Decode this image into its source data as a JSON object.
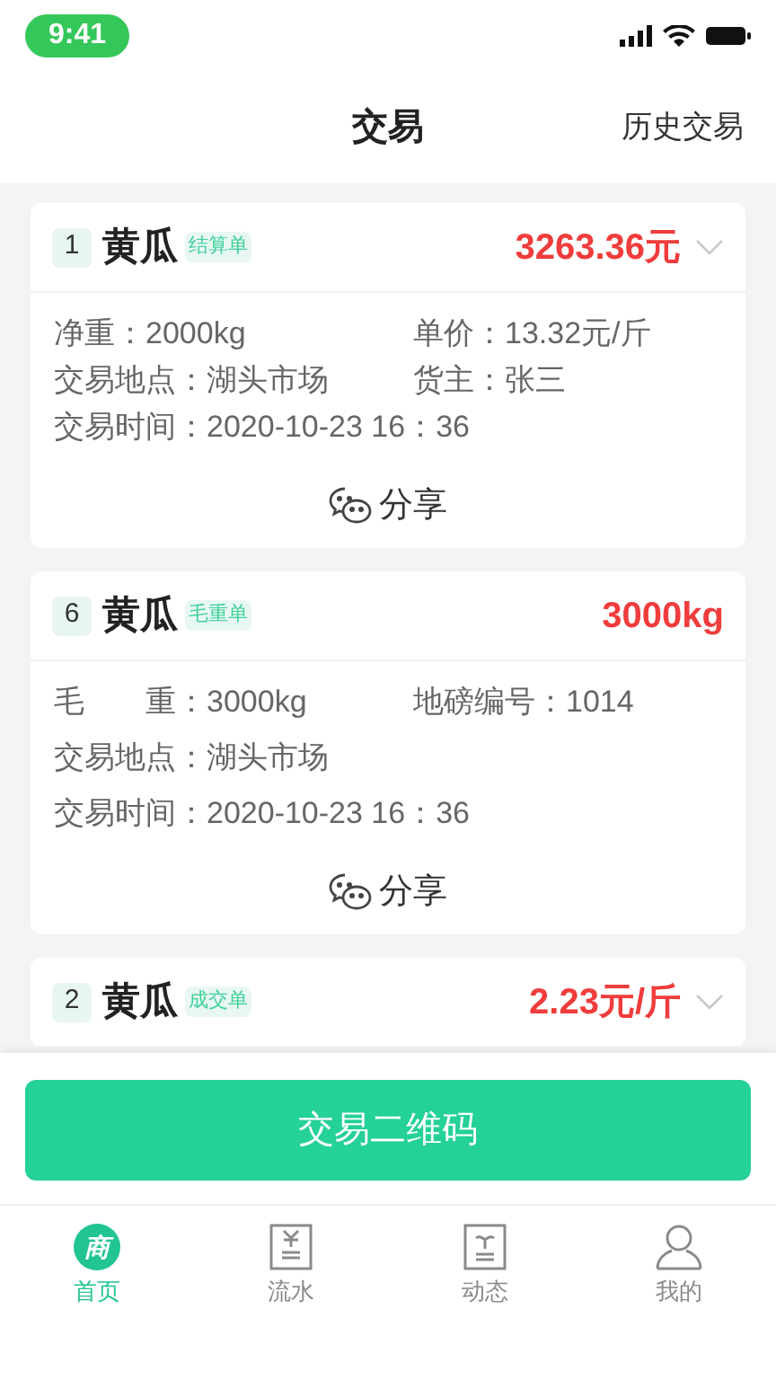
{
  "status_bar": {
    "time": "9:41"
  },
  "header": {
    "title": "交易",
    "action": "历史交易"
  },
  "cards": [
    {
      "index": "1",
      "name": "黄瓜",
      "tag": "结算单",
      "amount": "3263.36元",
      "collapsible": true,
      "rows": [
        [
          {
            "label": "净重：",
            "value": "2000kg"
          },
          {
            "label": "单价：",
            "value": "13.32元/斤"
          }
        ],
        [
          {
            "label": "交易地点：",
            "value": "湖头市场"
          },
          {
            "label": "货主：",
            "value": "张三"
          }
        ],
        [
          {
            "label": "交易时间：",
            "value": "2020-10-23 16：36"
          }
        ]
      ],
      "share": "分享"
    },
    {
      "index": "6",
      "name": "黄瓜",
      "tag": "毛重单",
      "amount": "3000kg",
      "collapsible": false,
      "rows": [
        [
          {
            "label": "毛　　重：",
            "value": "3000kg"
          },
          {
            "label": "地磅编号：",
            "value": "1014"
          }
        ],
        [
          {
            "label": "交易地点：",
            "value": "湖头市场"
          }
        ],
        [
          {
            "label": "交易时间：",
            "value": "2020-10-23 16：36"
          }
        ]
      ],
      "share": "分享"
    },
    {
      "index": "2",
      "name": "黄瓜",
      "tag": "成交单",
      "amount": "2.23元/斤",
      "collapsible": true
    }
  ],
  "primary_button": "交易二维码",
  "tab_bar": [
    {
      "kind": "home",
      "icon_text": "商",
      "label": "首页",
      "selected": true
    },
    {
      "kind": "ledger",
      "label": "流水",
      "selected": false
    },
    {
      "kind": "news",
      "label": "动态",
      "selected": false
    },
    {
      "kind": "profile",
      "label": "我的",
      "selected": false
    }
  ]
}
